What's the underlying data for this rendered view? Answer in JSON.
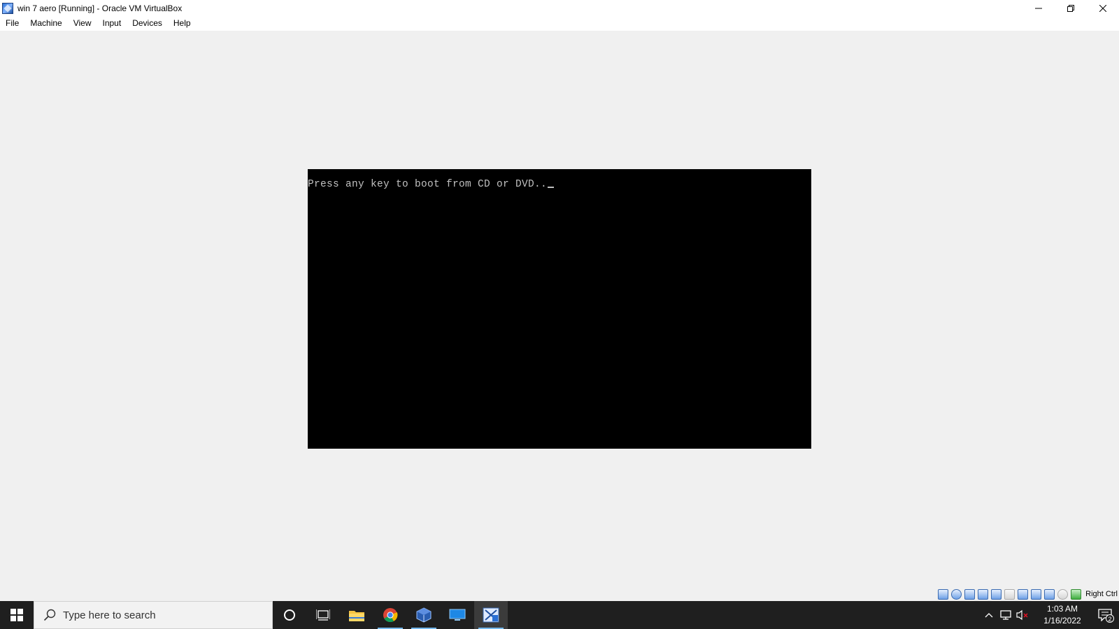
{
  "window": {
    "title": "win 7 aero [Running] - Oracle VM VirtualBox",
    "icon": "virtualbox-vm-icon",
    "controls": [
      "minimize-icon",
      "restore-icon",
      "close-icon"
    ]
  },
  "menu": {
    "items": [
      {
        "label": "File"
      },
      {
        "label": "Machine"
      },
      {
        "label": "View"
      },
      {
        "label": "Input"
      },
      {
        "label": "Devices"
      },
      {
        "label": "Help"
      }
    ]
  },
  "vm": {
    "console_text": "Press any key to boot from CD or DVD.."
  },
  "status_bar": {
    "icons": [
      "hard-disk-icon",
      "optical-drive-icon",
      "audio-icon",
      "network-icon",
      "usb-icon",
      "shared-folders-icon",
      "display-icon",
      "video-capture-icon",
      "virtualization-icon",
      "mouse-integration-icon",
      "keyboard-icon"
    ],
    "host_key": "Right Ctrl"
  },
  "taskbar": {
    "search_placeholder": "Type here to search",
    "apps": [
      "file-explorer-icon",
      "chrome-icon",
      "virtualbox-icon",
      "remote-desktop-icon",
      "virtualbox-vm-icon"
    ],
    "time": "1:03 AM",
    "date": "1/16/2022",
    "notification_count": "2"
  },
  "colors": {
    "vm_background": "#000000",
    "console_text": "#c0c0c0",
    "taskbar": "#1f1f1f",
    "window_bg": "#f0f0f0"
  }
}
